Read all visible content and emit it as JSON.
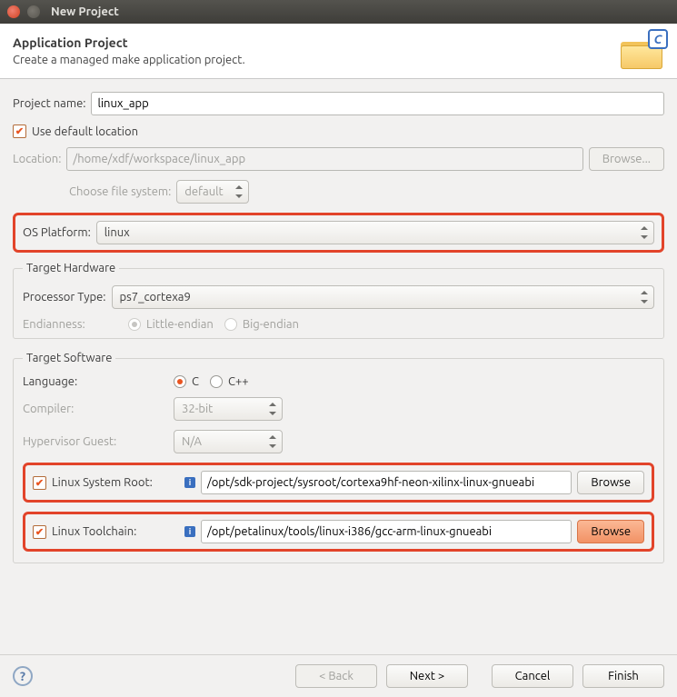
{
  "window": {
    "title": "New Project"
  },
  "banner": {
    "heading": "Application Project",
    "subtitle": "Create a managed make application project."
  },
  "project_name": {
    "label": "Project name:",
    "value": "linux_app"
  },
  "use_default": {
    "label": "Use default location"
  },
  "location": {
    "label": "Location:",
    "value": "/home/xdf/workspace/linux_app",
    "browse": "Browse...",
    "choose_fs": "Choose file system:",
    "fs_value": "default"
  },
  "os_platform": {
    "label": "OS Platform:",
    "value": "linux"
  },
  "target_hw": {
    "legend": "Target Hardware",
    "processor_label": "Processor Type:",
    "processor_value": "ps7_cortexa9",
    "endian_label": "Endianness:",
    "little": "Little-endian",
    "big": "Big-endian"
  },
  "target_sw": {
    "legend": "Target Software",
    "language_label": "Language:",
    "lang_c": "C",
    "lang_cpp": "C++",
    "compiler_label": "Compiler:",
    "compiler_value": "32-bit",
    "hypervisor_label": "Hypervisor Guest:",
    "hypervisor_value": "N/A",
    "sysroot_label": "Linux System Root:",
    "sysroot_value": "/opt/sdk-project/sysroot/cortexa9hf-neon-xilinx-linux-gnueabi",
    "toolchain_label": "Linux Toolchain:",
    "toolchain_value": "/opt/petalinux/tools/linux-i386/gcc-arm-linux-gnueabi",
    "browse": "Browse"
  },
  "footer": {
    "back": "< Back",
    "next": "Next >",
    "cancel": "Cancel",
    "finish": "Finish"
  }
}
